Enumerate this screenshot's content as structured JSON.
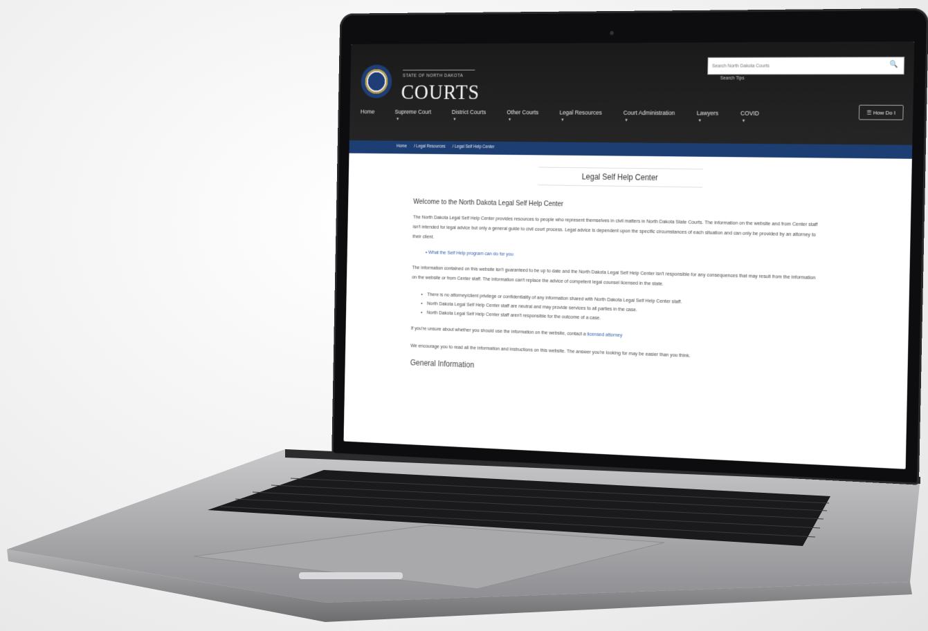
{
  "site": {
    "logo_small": "STATE OF NORTH DAKOTA",
    "logo_big": "COURTS",
    "search_placeholder": "Search North Dakota Courts",
    "search_tips": "Search Tips",
    "how_do_i": "How Do I"
  },
  "nav": [
    {
      "label": "Home"
    },
    {
      "label": "Supreme Court"
    },
    {
      "label": "District Courts"
    },
    {
      "label": "Other Courts"
    },
    {
      "label": "Legal Resources"
    },
    {
      "label": "Court Administration"
    },
    {
      "label": "Lawyers"
    },
    {
      "label": "COVID"
    }
  ],
  "breadcrumb": [
    "Home",
    "/ Legal Resources",
    "/ Legal Self Help Center"
  ],
  "page": {
    "title": "Legal Self Help Center",
    "welcome": "Welcome to the North Dakota Legal Self Help Center",
    "intro": "The North Dakota Legal Self Help Center provides resources to people who represent themselves in civil matters in North Dakota State Courts. The information on the website and from Center staff isn't intended for legal advice but only a general guide to civil court process. Legal advice is dependent upon the specific circumstances of each situation and can only be provided by an attorney to their client.",
    "link_program": "What the Self Help program can do for you",
    "disclaimer": "The information contained on this website isn't guaranteed to be up to date and the North Dakota Legal Self Help Center isn't responsible for any consequences that may result from the information on the website or from Center staff. The information can't replace the advice of competent legal counsel licensed in the state.",
    "bullets": [
      "There is no attorney/client privilege or confidentiality of any information shared with North Dakota Legal Self Help Center staff.",
      "North Dakota Legal Self Help Center staff are neutral and may provide services to all parties in the case.",
      "North Dakota Legal Self Help Center staff aren't responsible for the outcome of a case."
    ],
    "unsure_text": "If you're unsure about whether you should use the information on the website, contact a",
    "unsure_link": "licensed attorney",
    "encourage": "We encourage you to read all the information and instructions on this website. The answer you're looking for may be easier than you think.",
    "section_head": "General Information"
  }
}
